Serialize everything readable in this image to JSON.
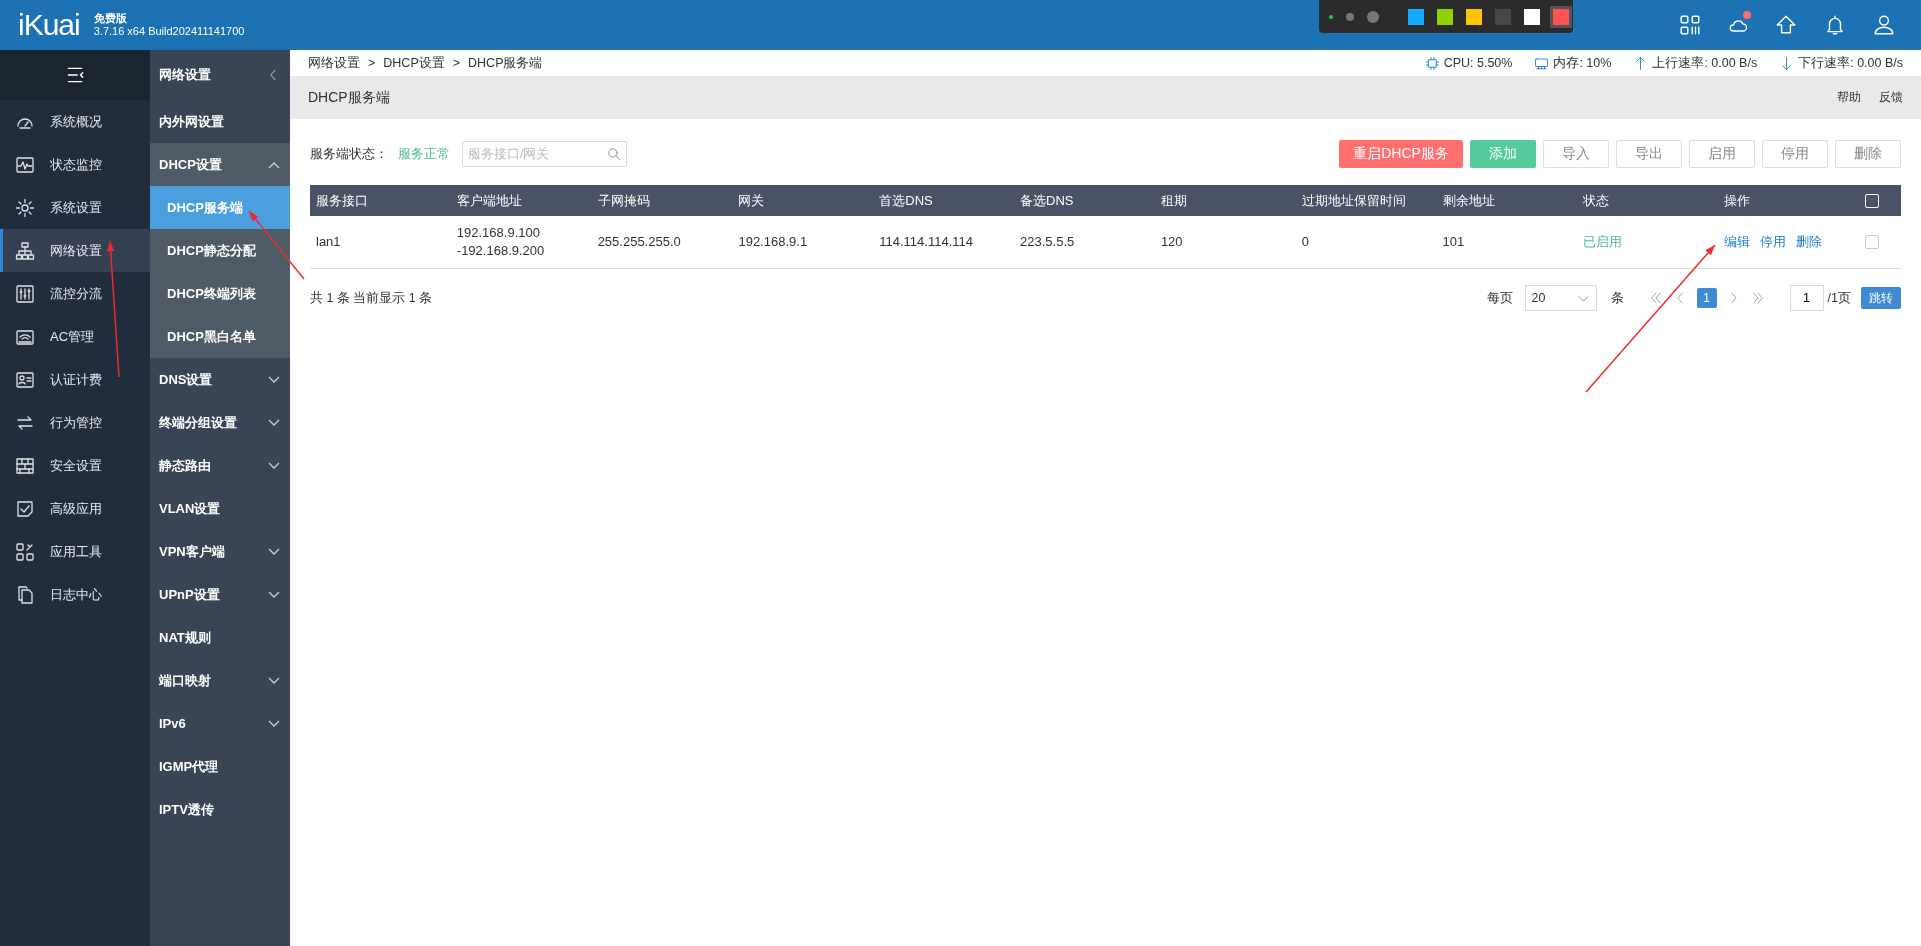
{
  "app": {
    "logo": "iKuai",
    "edition": "免费版",
    "version": "3.7.16 x64 Build202411141700"
  },
  "capture_toolbar": {
    "pen_sizes": [
      {
        "selected": true
      },
      {
        "selected": false
      },
      {
        "selected": false
      }
    ],
    "swatches": [
      {
        "color": "#12aaff",
        "selected": false
      },
      {
        "color": "#8fd400",
        "selected": false
      },
      {
        "color": "#ffc300",
        "selected": false
      },
      {
        "color": "#474747",
        "selected": false
      },
      {
        "color": "#ffffff",
        "selected": false
      },
      {
        "color": "#ff5252",
        "selected": true
      }
    ]
  },
  "nav": {
    "items": [
      {
        "label": "系统概况",
        "selected": false
      },
      {
        "label": "状态监控",
        "selected": false
      },
      {
        "label": "系统设置",
        "selected": false
      },
      {
        "label": "网络设置",
        "selected": true
      },
      {
        "label": "流控分流",
        "selected": false
      },
      {
        "label": "AC管理",
        "selected": false
      },
      {
        "label": "认证计费",
        "selected": false
      },
      {
        "label": "行为管控",
        "selected": false
      },
      {
        "label": "安全设置",
        "selected": false
      },
      {
        "label": "高级应用",
        "selected": false
      },
      {
        "label": "应用工具",
        "selected": false
      },
      {
        "label": "日志中心",
        "selected": false
      }
    ]
  },
  "subnav": {
    "title": "网络设置",
    "items": [
      {
        "label": "内外网设置",
        "kind": "link",
        "selected": false
      },
      {
        "label": "DHCP设置",
        "kind": "group",
        "expanded": true,
        "children": [
          {
            "label": "DHCP服务端",
            "selected": true
          },
          {
            "label": "DHCP静态分配",
            "selected": false
          },
          {
            "label": "DHCP终端列表",
            "selected": false
          },
          {
            "label": "DHCP黑白名单",
            "selected": false
          }
        ]
      },
      {
        "label": "DNS设置",
        "kind": "group",
        "expanded": false
      },
      {
        "label": "终端分组设置",
        "kind": "group",
        "expanded": false
      },
      {
        "label": "静态路由",
        "kind": "group",
        "expanded": false
      },
      {
        "label": "VLAN设置",
        "kind": "link",
        "selected": false
      },
      {
        "label": "VPN客户端",
        "kind": "group",
        "expanded": false
      },
      {
        "label": "UPnP设置",
        "kind": "group",
        "expanded": false
      },
      {
        "label": "NAT规则",
        "kind": "link",
        "selected": false
      },
      {
        "label": "端口映射",
        "kind": "group",
        "expanded": false
      },
      {
        "label": "IPv6",
        "kind": "group",
        "expanded": false
      },
      {
        "label": "IGMP代理",
        "kind": "link",
        "selected": false
      },
      {
        "label": "IPTV透传",
        "kind": "link",
        "selected": false
      }
    ]
  },
  "breadcrumb": [
    {
      "label": "网络设置",
      "separator": ">"
    },
    {
      "label": "DHCP设置",
      "separator": ">"
    },
    {
      "label": "DHCP服务端"
    }
  ],
  "stats": [
    {
      "kind": "cpu",
      "text": "CPU: 5.50%"
    },
    {
      "kind": "memory",
      "text": "内存: 10%"
    },
    {
      "kind": "upload",
      "text": "上行速率: 0.00 B/s"
    },
    {
      "kind": "download",
      "text": "下行速率: 0.00 B/s"
    }
  ],
  "page": {
    "title": "DHCP服务端",
    "links": [
      "帮助",
      "反馈"
    ]
  },
  "toolbar": {
    "status_label": "服务端状态：",
    "status": "服务正常",
    "search": {
      "placeholder": "服务接口/网关"
    },
    "buttons": [
      {
        "label": "重启DHCP服务",
        "kind": "danger"
      },
      {
        "label": "添加",
        "kind": "primary"
      },
      {
        "label": "导入",
        "kind": "plain"
      },
      {
        "label": "导出",
        "kind": "plain"
      },
      {
        "label": "启用",
        "kind": "plain"
      },
      {
        "label": "停用",
        "kind": "plain"
      },
      {
        "label": "删除",
        "kind": "plain"
      }
    ]
  },
  "table": {
    "columns": [
      "服务接口",
      "客户端地址",
      "子网掩码",
      "网关",
      "首选DNS",
      "备选DNS",
      "租期",
      "过期地址保留时间",
      "剩余地址",
      "状态",
      "操作"
    ],
    "select_all": {
      "checked": false
    },
    "rows": [
      {
        "cells": [
          "lan1",
          "192.168.9.100\n-192.168.9.200",
          "255.255.255.0",
          "192.168.9.1",
          "114.114.114.114",
          "223.5.5.5",
          "120",
          "0",
          "101"
        ],
        "status": "已启用",
        "enabled": true,
        "actions": [
          "编辑",
          "停用",
          "删除"
        ],
        "checked": false
      }
    ]
  },
  "footer": {
    "summary": "共 1 条 当前显示 1 条",
    "per_page_label": "每页",
    "per_page": "20",
    "per_page_unit": "条",
    "pages": [
      {
        "label": "1",
        "selected": true
      }
    ],
    "page_input": "1",
    "total_pages": "/1页",
    "jump": "跳转"
  }
}
